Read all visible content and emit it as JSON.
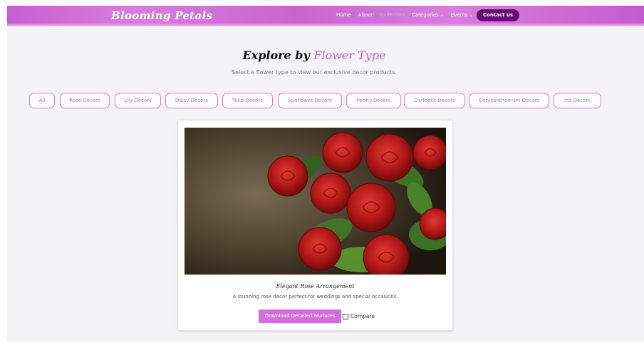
{
  "navbar": {
    "brand": "Blooming Petals",
    "links": [
      {
        "label": "Home"
      },
      {
        "label": "About"
      },
      {
        "label": "Collection"
      },
      {
        "label": "Categories"
      },
      {
        "label": "Events"
      }
    ],
    "caret": "⌄",
    "contact_label": "Contact us"
  },
  "header": {
    "title_prefix": "Explore by",
    "title_accent": "Flower Type",
    "subtitle": "Select a flower type to view our exclusive decor products."
  },
  "filters": [
    "All",
    "Rose Decors",
    "Lily Decors",
    "Daisy Decors",
    "Tulip Decors",
    "Sunflower Decors",
    "Peony Decors",
    "Daffodils Decors",
    "Chrysanthemum Decors",
    "Iris Decors"
  ],
  "product": {
    "title": "Elegant Rose Arrangement",
    "description": "A stunning rose decor perfect for weddings and special occasions.",
    "download_label": "Download Detailed Features",
    "compare_label": "Compare"
  },
  "colors": {
    "accent": "#c95bd2",
    "contact_button": "#6a0a78",
    "download_button": "#d16ed9"
  }
}
